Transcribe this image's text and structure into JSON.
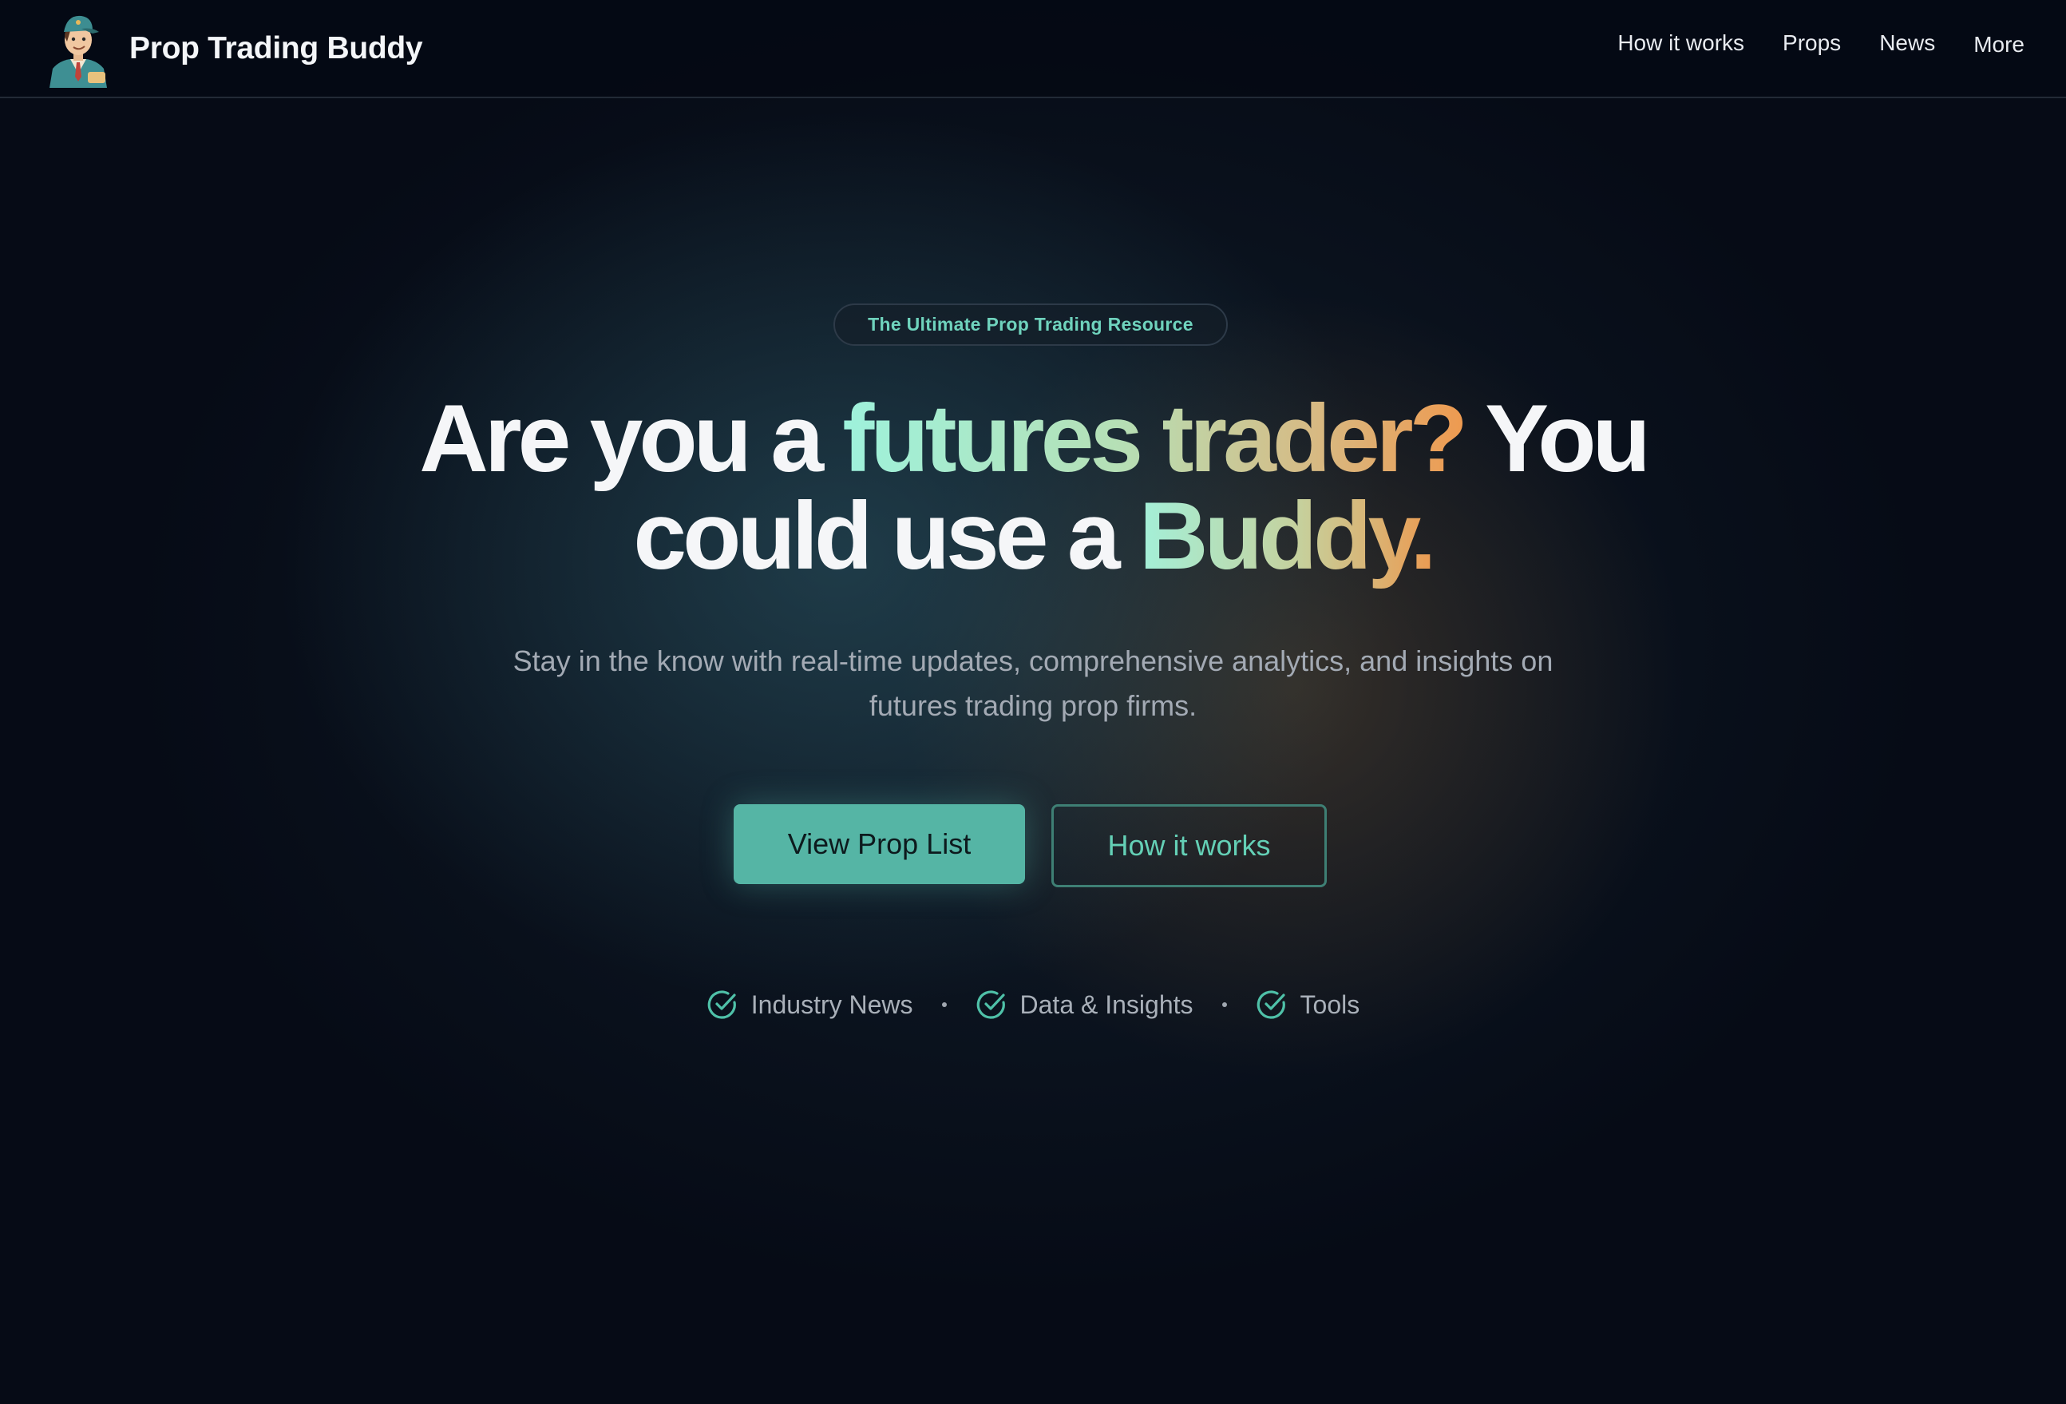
{
  "header": {
    "brand_name": "Prop Trading Buddy",
    "nav": [
      {
        "label": "How it works"
      },
      {
        "label": "Props"
      },
      {
        "label": "News"
      },
      {
        "label": "More"
      }
    ]
  },
  "hero": {
    "badge": "The Ultimate Prop Trading Resource",
    "headline": {
      "part1": "Are you a ",
      "highlight1": "futures trader?",
      "part2": " You",
      "part3": "could use a ",
      "highlight2": "Buddy."
    },
    "subtitle_line1": "Stay in the know with real-time updates, comprehensive analytics, and insights on",
    "subtitle_line2": "futures trading prop firms.",
    "primary_button": "View Prop List",
    "secondary_button": "How it works",
    "features": [
      {
        "label": "Industry News",
        "icon": "check-circle-icon"
      },
      {
        "label": "Data & Insights",
        "icon": "check-circle-icon"
      },
      {
        "label": "Tools",
        "icon": "check-circle-icon"
      }
    ]
  },
  "colors": {
    "background": "#060b16",
    "accent_teal": "#55b5a5",
    "accent_orange": "#ee9a50",
    "badge_text": "#6fd3bd"
  }
}
